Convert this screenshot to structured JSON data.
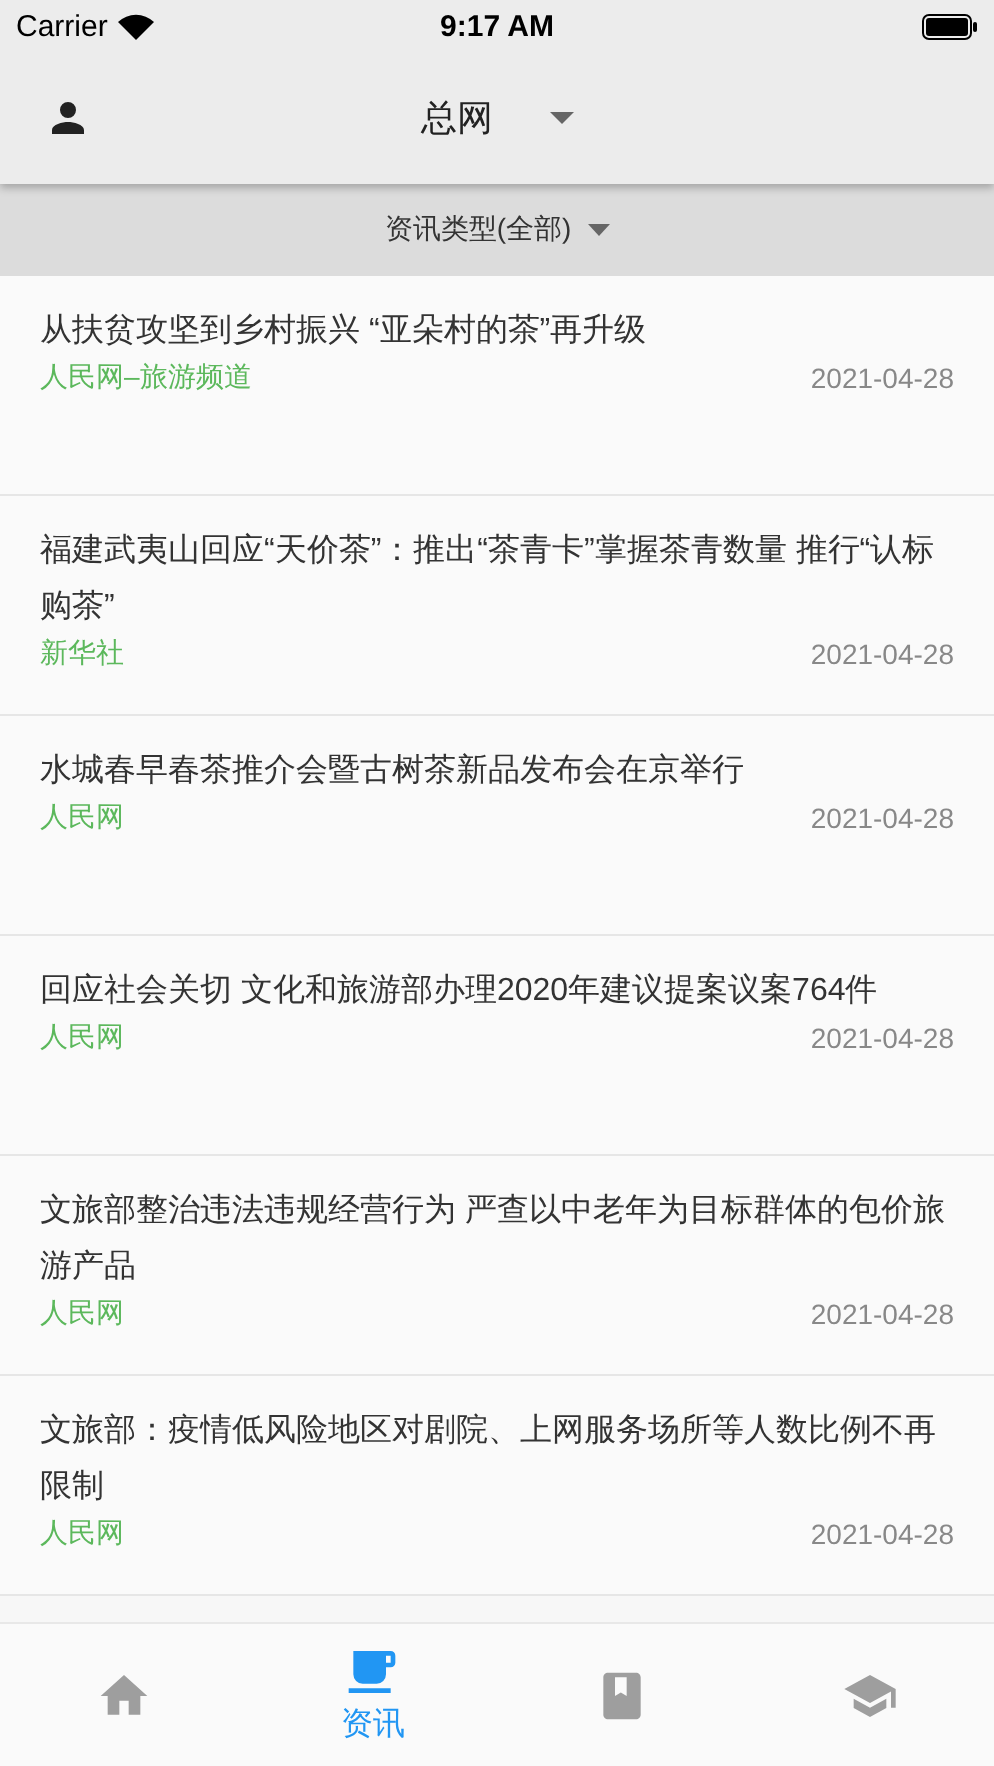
{
  "status_bar": {
    "carrier": "Carrier",
    "time": "9:17 AM"
  },
  "header": {
    "title": "总网"
  },
  "filter": {
    "label": "资讯类型(全部)"
  },
  "articles": [
    {
      "title": "从扶贫攻坚到乡村振兴 “亚朵村的茶”再升级",
      "source": "人民网–旅游频道",
      "date": "2021-04-28"
    },
    {
      "title": "福建武夷山回应“天价茶”：推出“茶青卡”掌握茶青数量 推行“认标购茶”",
      "source": "新华社",
      "date": "2021-04-28"
    },
    {
      "title": "水城春早春茶推介会暨古树茶新品发布会在京举行",
      "source": "人民网",
      "date": "2021-04-28"
    },
    {
      "title": "回应社会关切 文化和旅游部办理2020年建议提案议案764件",
      "source": "人民网",
      "date": "2021-04-28"
    },
    {
      "title": "文旅部整治违法违规经营行为 严查以中老年为目标群体的包价旅游产品",
      "source": "人民网",
      "date": "2021-04-28"
    },
    {
      "title": "文旅部：疫情低风险地区对剧院、上网服务场所等人数比例不再限制",
      "source": "人民网",
      "date": "2021-04-28"
    }
  ],
  "tab_bar": [
    {
      "kind": "home",
      "selected": false
    },
    {
      "kind": "news",
      "label": "资讯",
      "selected": true
    },
    {
      "kind": "book",
      "selected": false
    },
    {
      "kind": "school",
      "selected": false
    }
  ]
}
